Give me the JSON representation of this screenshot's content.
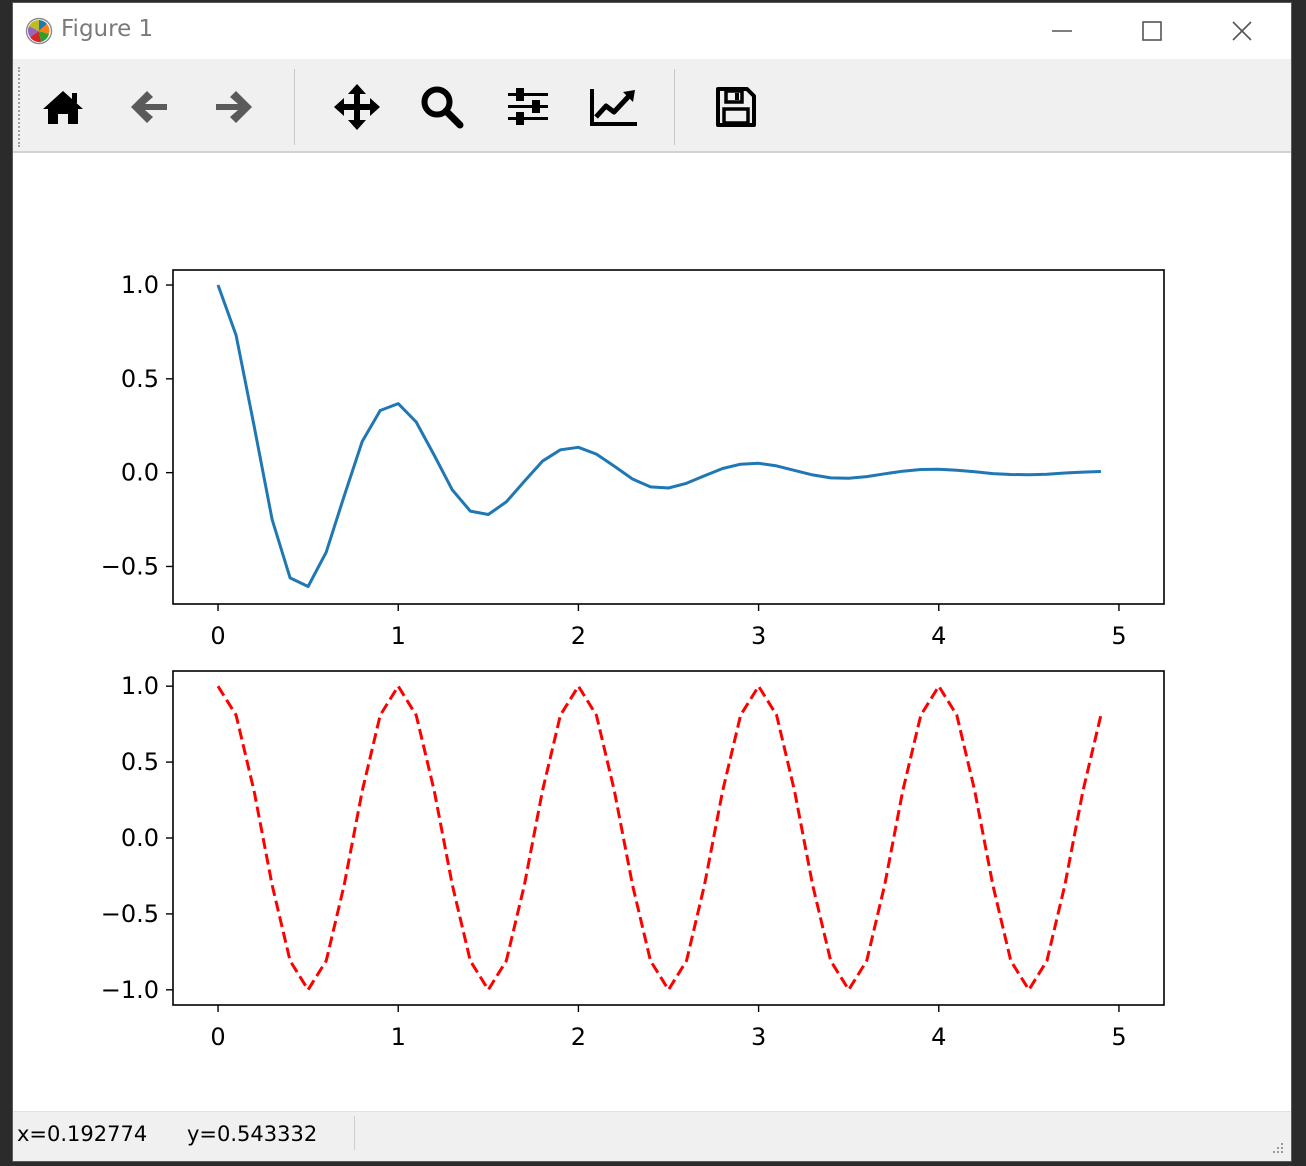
{
  "window": {
    "title": "Figure 1",
    "controls": {
      "minimize_icon": "minimize-icon",
      "maximize_icon": "maximize-icon",
      "close_icon": "close-icon"
    }
  },
  "toolbar": {
    "tools": [
      {
        "name": "home",
        "icon": "home-icon"
      },
      {
        "name": "back",
        "icon": "arrow-left-icon"
      },
      {
        "name": "forward",
        "icon": "arrow-right-icon"
      },
      {
        "name": "pan",
        "icon": "move-icon"
      },
      {
        "name": "zoom",
        "icon": "zoom-icon"
      },
      {
        "name": "configure-subplots",
        "icon": "sliders-icon"
      },
      {
        "name": "edit-axes",
        "icon": "line-chart-icon"
      },
      {
        "name": "save",
        "icon": "save-icon"
      }
    ]
  },
  "chart_data": [
    {
      "type": "line",
      "title": "",
      "xlabel": "",
      "ylabel": "",
      "xlim": [
        -0.25,
        5.25
      ],
      "ylim": [
        -0.7,
        1.08
      ],
      "xticks": [
        "0",
        "1",
        "2",
        "3",
        "4",
        "5"
      ],
      "yticks": [
        "1.0",
        "0.5",
        "0.0",
        "−0.5"
      ],
      "grid": false,
      "series": [
        {
          "color": "#1f77b4",
          "style": "solid",
          "x": [
            0.0,
            0.1,
            0.2,
            0.3,
            0.4,
            0.5,
            0.6,
            0.7,
            0.8,
            0.9,
            1.0,
            1.1,
            1.2,
            1.3,
            1.4,
            1.5,
            1.6,
            1.7,
            1.8,
            1.9,
            2.0,
            2.1,
            2.2,
            2.3,
            2.4,
            2.5,
            2.6,
            2.7,
            2.8,
            2.9,
            3.0,
            3.1,
            3.2,
            3.3,
            3.4,
            3.5,
            3.6,
            3.7,
            3.8,
            3.9,
            4.0,
            4.1,
            4.2,
            4.3,
            4.4,
            4.5,
            4.6,
            4.7,
            4.8,
            4.9
          ],
          "y": [
            1.0,
            0.732,
            0.249,
            -0.249,
            -0.561,
            -0.607,
            -0.424,
            -0.124,
            0.166,
            0.331,
            0.368,
            0.27,
            0.092,
            -0.092,
            -0.205,
            -0.223,
            -0.156,
            -0.046,
            0.061,
            0.122,
            0.135,
            0.099,
            0.034,
            -0.034,
            -0.076,
            -0.082,
            -0.057,
            -0.017,
            0.022,
            0.045,
            0.05,
            0.036,
            0.012,
            -0.012,
            -0.028,
            -0.03,
            -0.021,
            -0.006,
            0.008,
            0.017,
            0.018,
            0.013,
            0.005,
            -0.005,
            -0.01,
            -0.011,
            -0.008,
            -0.002,
            0.003,
            0.006
          ]
        }
      ]
    },
    {
      "type": "line",
      "title": "",
      "xlabel": "",
      "ylabel": "",
      "xlim": [
        -0.25,
        5.25
      ],
      "ylim": [
        -1.1,
        1.1
      ],
      "xticks": [
        "0",
        "1",
        "2",
        "3",
        "4",
        "5"
      ],
      "yticks": [
        "1.0",
        "0.5",
        "0.0",
        "−0.5",
        "−1.0"
      ],
      "grid": false,
      "series": [
        {
          "color": "#ff0000",
          "style": "dashed",
          "x": [
            0.0,
            0.1,
            0.2,
            0.3,
            0.4,
            0.5,
            0.6,
            0.7,
            0.8,
            0.9,
            1.0,
            1.1,
            1.2,
            1.3,
            1.4,
            1.5,
            1.6,
            1.7,
            1.8,
            1.9,
            2.0,
            2.1,
            2.2,
            2.3,
            2.4,
            2.5,
            2.6,
            2.7,
            2.8,
            2.9,
            3.0,
            3.1,
            3.2,
            3.3,
            3.4,
            3.5,
            3.6,
            3.7,
            3.8,
            3.9,
            4.0,
            4.1,
            4.2,
            4.3,
            4.4,
            4.5,
            4.6,
            4.7,
            4.8,
            4.9
          ],
          "y": [
            1.0,
            0.809,
            0.309,
            -0.309,
            -0.809,
            -1.0,
            -0.809,
            -0.309,
            0.309,
            0.809,
            1.0,
            0.809,
            0.309,
            -0.309,
            -0.809,
            -1.0,
            -0.809,
            -0.309,
            0.309,
            0.809,
            1.0,
            0.809,
            0.309,
            -0.309,
            -0.809,
            -1.0,
            -0.809,
            -0.309,
            0.309,
            0.809,
            1.0,
            0.809,
            0.309,
            -0.309,
            -0.809,
            -1.0,
            -0.809,
            -0.309,
            0.309,
            0.809,
            1.0,
            0.809,
            0.309,
            -0.309,
            -0.809,
            -1.0,
            -0.809,
            -0.309,
            0.309,
            0.809
          ]
        }
      ]
    }
  ],
  "status": {
    "x_readout": "x=0.192774",
    "y_readout": "y=0.543332"
  }
}
